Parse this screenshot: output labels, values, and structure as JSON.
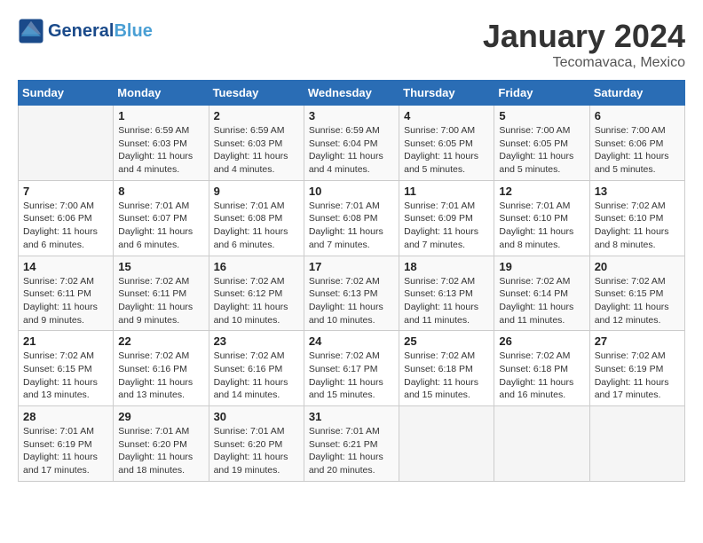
{
  "header": {
    "logo_line1": "General",
    "logo_line2": "Blue",
    "title": "January 2024",
    "subtitle": "Tecomavaca, Mexico"
  },
  "days_of_week": [
    "Sunday",
    "Monday",
    "Tuesday",
    "Wednesday",
    "Thursday",
    "Friday",
    "Saturday"
  ],
  "weeks": [
    [
      {
        "day": "",
        "sunrise": "",
        "sunset": "",
        "daylight": ""
      },
      {
        "day": "1",
        "sunrise": "Sunrise: 6:59 AM",
        "sunset": "Sunset: 6:03 PM",
        "daylight": "Daylight: 11 hours and 4 minutes."
      },
      {
        "day": "2",
        "sunrise": "Sunrise: 6:59 AM",
        "sunset": "Sunset: 6:03 PM",
        "daylight": "Daylight: 11 hours and 4 minutes."
      },
      {
        "day": "3",
        "sunrise": "Sunrise: 6:59 AM",
        "sunset": "Sunset: 6:04 PM",
        "daylight": "Daylight: 11 hours and 4 minutes."
      },
      {
        "day": "4",
        "sunrise": "Sunrise: 7:00 AM",
        "sunset": "Sunset: 6:05 PM",
        "daylight": "Daylight: 11 hours and 5 minutes."
      },
      {
        "day": "5",
        "sunrise": "Sunrise: 7:00 AM",
        "sunset": "Sunset: 6:05 PM",
        "daylight": "Daylight: 11 hours and 5 minutes."
      },
      {
        "day": "6",
        "sunrise": "Sunrise: 7:00 AM",
        "sunset": "Sunset: 6:06 PM",
        "daylight": "Daylight: 11 hours and 5 minutes."
      }
    ],
    [
      {
        "day": "7",
        "sunrise": "Sunrise: 7:00 AM",
        "sunset": "Sunset: 6:06 PM",
        "daylight": "Daylight: 11 hours and 6 minutes."
      },
      {
        "day": "8",
        "sunrise": "Sunrise: 7:01 AM",
        "sunset": "Sunset: 6:07 PM",
        "daylight": "Daylight: 11 hours and 6 minutes."
      },
      {
        "day": "9",
        "sunrise": "Sunrise: 7:01 AM",
        "sunset": "Sunset: 6:08 PM",
        "daylight": "Daylight: 11 hours and 6 minutes."
      },
      {
        "day": "10",
        "sunrise": "Sunrise: 7:01 AM",
        "sunset": "Sunset: 6:08 PM",
        "daylight": "Daylight: 11 hours and 7 minutes."
      },
      {
        "day": "11",
        "sunrise": "Sunrise: 7:01 AM",
        "sunset": "Sunset: 6:09 PM",
        "daylight": "Daylight: 11 hours and 7 minutes."
      },
      {
        "day": "12",
        "sunrise": "Sunrise: 7:01 AM",
        "sunset": "Sunset: 6:10 PM",
        "daylight": "Daylight: 11 hours and 8 minutes."
      },
      {
        "day": "13",
        "sunrise": "Sunrise: 7:02 AM",
        "sunset": "Sunset: 6:10 PM",
        "daylight": "Daylight: 11 hours and 8 minutes."
      }
    ],
    [
      {
        "day": "14",
        "sunrise": "Sunrise: 7:02 AM",
        "sunset": "Sunset: 6:11 PM",
        "daylight": "Daylight: 11 hours and 9 minutes."
      },
      {
        "day": "15",
        "sunrise": "Sunrise: 7:02 AM",
        "sunset": "Sunset: 6:11 PM",
        "daylight": "Daylight: 11 hours and 9 minutes."
      },
      {
        "day": "16",
        "sunrise": "Sunrise: 7:02 AM",
        "sunset": "Sunset: 6:12 PM",
        "daylight": "Daylight: 11 hours and 10 minutes."
      },
      {
        "day": "17",
        "sunrise": "Sunrise: 7:02 AM",
        "sunset": "Sunset: 6:13 PM",
        "daylight": "Daylight: 11 hours and 10 minutes."
      },
      {
        "day": "18",
        "sunrise": "Sunrise: 7:02 AM",
        "sunset": "Sunset: 6:13 PM",
        "daylight": "Daylight: 11 hours and 11 minutes."
      },
      {
        "day": "19",
        "sunrise": "Sunrise: 7:02 AM",
        "sunset": "Sunset: 6:14 PM",
        "daylight": "Daylight: 11 hours and 11 minutes."
      },
      {
        "day": "20",
        "sunrise": "Sunrise: 7:02 AM",
        "sunset": "Sunset: 6:15 PM",
        "daylight": "Daylight: 11 hours and 12 minutes."
      }
    ],
    [
      {
        "day": "21",
        "sunrise": "Sunrise: 7:02 AM",
        "sunset": "Sunset: 6:15 PM",
        "daylight": "Daylight: 11 hours and 13 minutes."
      },
      {
        "day": "22",
        "sunrise": "Sunrise: 7:02 AM",
        "sunset": "Sunset: 6:16 PM",
        "daylight": "Daylight: 11 hours and 13 minutes."
      },
      {
        "day": "23",
        "sunrise": "Sunrise: 7:02 AM",
        "sunset": "Sunset: 6:16 PM",
        "daylight": "Daylight: 11 hours and 14 minutes."
      },
      {
        "day": "24",
        "sunrise": "Sunrise: 7:02 AM",
        "sunset": "Sunset: 6:17 PM",
        "daylight": "Daylight: 11 hours and 15 minutes."
      },
      {
        "day": "25",
        "sunrise": "Sunrise: 7:02 AM",
        "sunset": "Sunset: 6:18 PM",
        "daylight": "Daylight: 11 hours and 15 minutes."
      },
      {
        "day": "26",
        "sunrise": "Sunrise: 7:02 AM",
        "sunset": "Sunset: 6:18 PM",
        "daylight": "Daylight: 11 hours and 16 minutes."
      },
      {
        "day": "27",
        "sunrise": "Sunrise: 7:02 AM",
        "sunset": "Sunset: 6:19 PM",
        "daylight": "Daylight: 11 hours and 17 minutes."
      }
    ],
    [
      {
        "day": "28",
        "sunrise": "Sunrise: 7:01 AM",
        "sunset": "Sunset: 6:19 PM",
        "daylight": "Daylight: 11 hours and 17 minutes."
      },
      {
        "day": "29",
        "sunrise": "Sunrise: 7:01 AM",
        "sunset": "Sunset: 6:20 PM",
        "daylight": "Daylight: 11 hours and 18 minutes."
      },
      {
        "day": "30",
        "sunrise": "Sunrise: 7:01 AM",
        "sunset": "Sunset: 6:20 PM",
        "daylight": "Daylight: 11 hours and 19 minutes."
      },
      {
        "day": "31",
        "sunrise": "Sunrise: 7:01 AM",
        "sunset": "Sunset: 6:21 PM",
        "daylight": "Daylight: 11 hours and 20 minutes."
      },
      {
        "day": "",
        "sunrise": "",
        "sunset": "",
        "daylight": ""
      },
      {
        "day": "",
        "sunrise": "",
        "sunset": "",
        "daylight": ""
      },
      {
        "day": "",
        "sunrise": "",
        "sunset": "",
        "daylight": ""
      }
    ]
  ]
}
